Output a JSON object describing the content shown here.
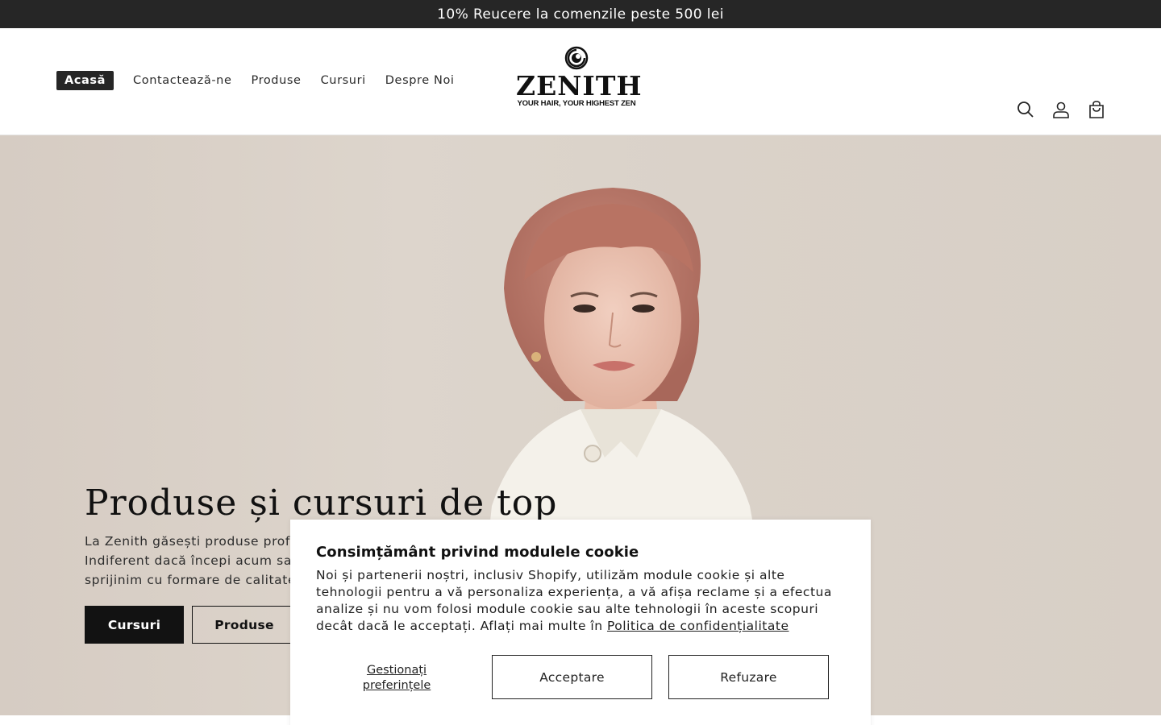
{
  "announcement": {
    "text": "10% Reucere la comenzile peste 500 lei"
  },
  "nav": {
    "items": [
      {
        "label": "Acasă",
        "active": true
      },
      {
        "label": "Contactează-ne"
      },
      {
        "label": "Produse"
      },
      {
        "label": "Cursuri"
      },
      {
        "label": "Despre Noi"
      }
    ]
  },
  "logo": {
    "name": "ZENITH",
    "tagline": "YOUR HAIR, YOUR HIGHEST ZEN"
  },
  "header_icons": [
    "search-icon",
    "account-icon",
    "cart-icon"
  ],
  "hero": {
    "title": "Produse și cursuri de top",
    "lines": [
      "La Zenith găsești produse profe",
      "Indiferent dacă începi acum sa",
      "sprijinim cu formare de calitate"
    ],
    "primary_button": "Cursuri",
    "secondary_button": "Produse"
  },
  "cookie": {
    "title": "Consimțământ privind modulele cookie",
    "text": "Noi și partenerii noștri, inclusiv Shopify, utilizăm module cookie și alte tehnologii pentru a vă personaliza experiența, a vă afișa reclame și a efectua analize și nu vom folosi module cookie sau alte tehnologii în aceste scopuri decât dacă le acceptați. Aflați mai multe în",
    "link": "Politica de confidențialitate",
    "manage": "Gestionați preferințele",
    "accept": "Acceptare",
    "reject": "Refuzare"
  },
  "colors": {
    "announcement_bg": "#262626",
    "hero_bg": "#d8cfc6",
    "button_dark": "#121212"
  }
}
